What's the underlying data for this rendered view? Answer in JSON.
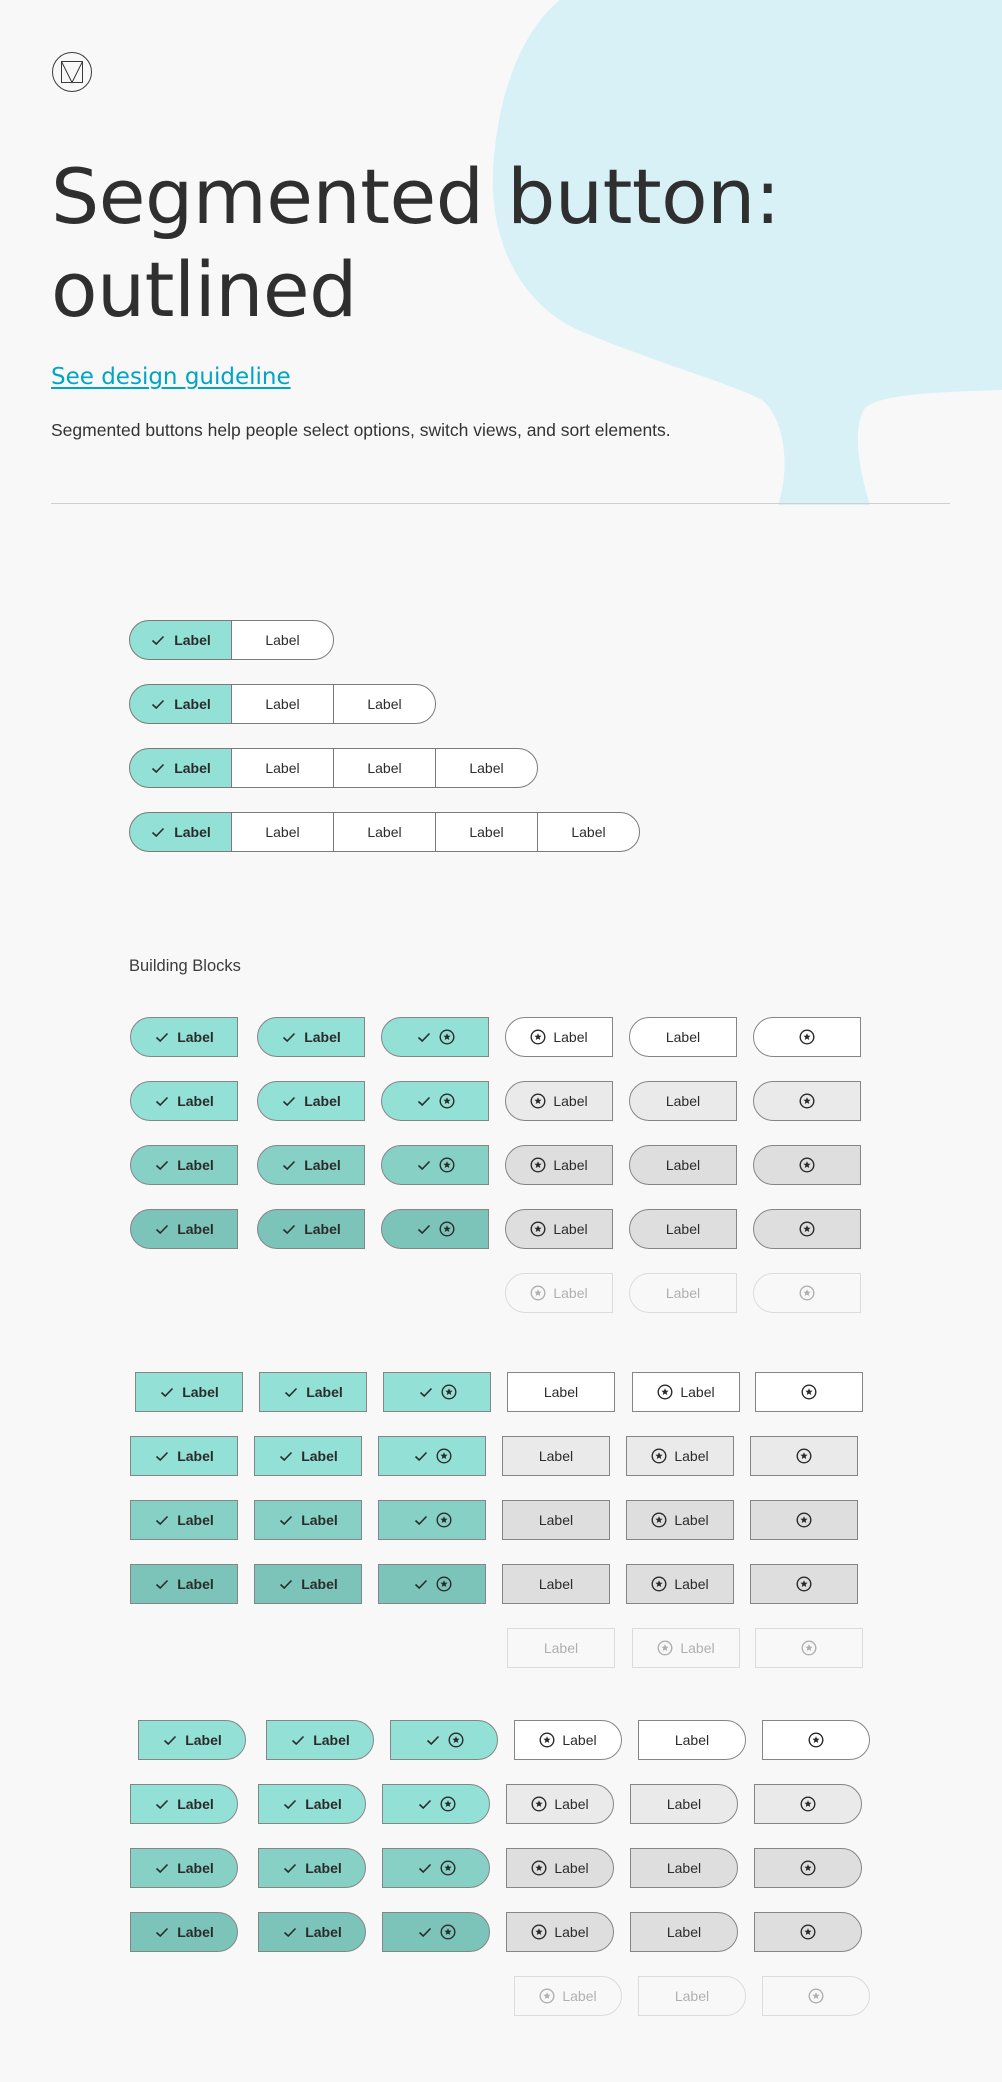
{
  "header": {
    "title": "Segmented button: outlined",
    "guideline_link": "See design guideline",
    "description": "Segmented buttons help people select options, switch views, and sort elements."
  },
  "segmented_rows": [
    {
      "segments": [
        "Label",
        "Label"
      ],
      "selected_index": 0
    },
    {
      "segments": [
        "Label",
        "Label",
        "Label"
      ],
      "selected_index": 0
    },
    {
      "segments": [
        "Label",
        "Label",
        "Label",
        "Label"
      ],
      "selected_index": 0
    },
    {
      "segments": [
        "Label",
        "Label",
        "Label",
        "Label",
        "Label"
      ],
      "selected_index": 0
    }
  ],
  "building_blocks": {
    "heading": "Building Blocks",
    "button_label": "Label",
    "state_levels": [
      "enabled",
      "hovered",
      "focused",
      "pressed",
      "disabled"
    ],
    "groups": [
      {
        "name": "left-segment",
        "columns": [
          {
            "selected": true,
            "content": "check-label"
          },
          {
            "selected": true,
            "content": "check-label"
          },
          {
            "selected": true,
            "content": "check-icon"
          },
          {
            "selected": false,
            "content": "icon-label"
          },
          {
            "selected": false,
            "content": "label"
          },
          {
            "selected": false,
            "content": "icon"
          }
        ]
      },
      {
        "name": "middle-segment",
        "columns": [
          {
            "selected": true,
            "content": "check-label"
          },
          {
            "selected": true,
            "content": "check-label"
          },
          {
            "selected": true,
            "content": "check-icon"
          },
          {
            "selected": false,
            "content": "label"
          },
          {
            "selected": false,
            "content": "icon-label"
          },
          {
            "selected": false,
            "content": "icon"
          }
        ]
      },
      {
        "name": "right-segment",
        "columns": [
          {
            "selected": true,
            "content": "check-label"
          },
          {
            "selected": true,
            "content": "check-label"
          },
          {
            "selected": true,
            "content": "check-icon"
          },
          {
            "selected": false,
            "content": "icon-label"
          },
          {
            "selected": false,
            "content": "label"
          },
          {
            "selected": false,
            "content": "icon"
          }
        ]
      }
    ]
  },
  "colors": {
    "accent_link": "#00a5c6",
    "hero_blob": "#d8f1f7",
    "selected_enabled": "#93e0d6",
    "selected_hover": "#87d0c6",
    "selected_pressed": "#7cc4ba",
    "unselected_hover": "#eaeaea",
    "unselected_pressed": "#dedede",
    "outline": "#7a7a7a",
    "disabled_text": "#b0b0b0"
  },
  "icons": {
    "logo": "material-logo-icon",
    "check": "check-icon",
    "star": "star-circle-icon"
  }
}
